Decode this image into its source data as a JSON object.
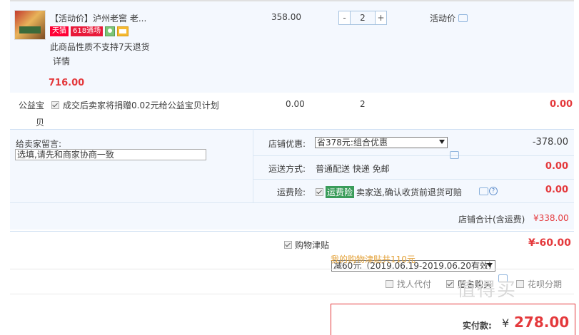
{
  "item": {
    "title": "【活动价】泸州老窖 老...",
    "badges": {
      "tmall": "天猫",
      "event": "618通场"
    },
    "notice": "此商品性质不支持7天退货",
    "detail_link": "详情",
    "price": "358.00",
    "quantity": "2",
    "minus": "-",
    "plus": "+",
    "promo_label": "活动价",
    "subtotal": "716.00"
  },
  "charity": {
    "label_line1": "公益宝",
    "label_line2": "贝",
    "text": "成交后卖家将捐赠0.02元给公益宝贝计划",
    "price": "0.00",
    "qty": "2",
    "sum": "0.00"
  },
  "message": {
    "label": "给卖家留言:",
    "placeholder": "选填,请先和商家协商一致"
  },
  "shop_discount": {
    "label": "店铺优惠:",
    "selected": "省378元:组合优惠",
    "amount": "-378.00"
  },
  "shipping": {
    "label": "运送方式:",
    "value": "普通配送 快递 免邮",
    "amount": "0.00"
  },
  "freight_insurance": {
    "label": "运费险:",
    "tag": "运费险",
    "text": "卖家送,确认收货前退货可赔",
    "help": "?",
    "amount": "0.00"
  },
  "shop_total": {
    "label": "店铺合计(含运费)",
    "amount": "¥338.00"
  },
  "subsidy": {
    "label": "购物津贴",
    "selected": "减60元（2019.06.19-2019.06.20有效）",
    "amount": "¥-60.00",
    "note": "我的购物津贴共110元"
  },
  "options": {
    "proxy_pay": "找人代付",
    "anonymous": "匿名购买",
    "huabei": "花呗分期"
  },
  "payment": {
    "label": "实付款:",
    "currency": "¥",
    "amount": "278.00"
  },
  "watermark": "值得买",
  "colors": {
    "accent_red": "#e4393c",
    "light_blue_bg": "#f4f8fe",
    "green_tag": "#3a9c5a"
  }
}
